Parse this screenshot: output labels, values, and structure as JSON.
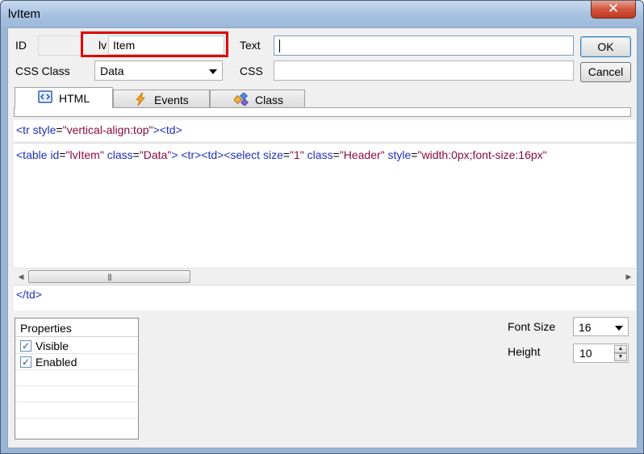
{
  "window": {
    "title": "lvItem",
    "close_glyph": "✕"
  },
  "form": {
    "id_label": "ID",
    "id_prefix": "lv",
    "id_value": "Item",
    "text_label": "Text",
    "text_value": "",
    "css_class_label": "CSS Class",
    "css_class_value": "Data",
    "css_label": "CSS",
    "css_value": ""
  },
  "buttons": {
    "ok": "OK",
    "cancel": "Cancel"
  },
  "tabs": [
    {
      "label": "HTML",
      "icon": "html-code-icon"
    },
    {
      "label": "Events",
      "icon": "lightning-icon"
    },
    {
      "label": "Class",
      "icon": "class-icon"
    }
  ],
  "html": {
    "prefix": {
      "t1": "<tr ",
      "a1": "style",
      "e1": "=",
      "s1": "\"vertical-align:top\"",
      "t2": "><td>"
    },
    "body": {
      "t1": "<table ",
      "a1": "id",
      "e1": "=",
      "s1": "\"lvItem\"",
      "a2": " class",
      "e2": "=",
      "s2": "\"Data\"",
      "t2": ">  <tr><td><select ",
      "a3": "size",
      "e3": "=",
      "s3": "\"1\"",
      "a4": " class",
      "e4": "=",
      "s4": "\"Header\"",
      "a5": " style",
      "e5": "=",
      "s5": "\"width:0px;font-size:16px\""
    },
    "suffix": "</td>",
    "scroll_left": "◀",
    "scroll_right": "▶",
    "thumb_grip": "|||"
  },
  "properties": {
    "header": "Properties",
    "items": [
      {
        "label": "Visible",
        "checked": true
      },
      {
        "label": "Enabled",
        "checked": true
      }
    ],
    "check_glyph": "✓"
  },
  "font_size": {
    "label": "Font Size",
    "value": "16"
  },
  "height": {
    "label": "Height",
    "value": "10",
    "up": "▲",
    "down": "▼"
  },
  "colors": {
    "highlight_box": "#e00000",
    "tag": "#1f2fbf",
    "string": "#8b0a3c"
  }
}
